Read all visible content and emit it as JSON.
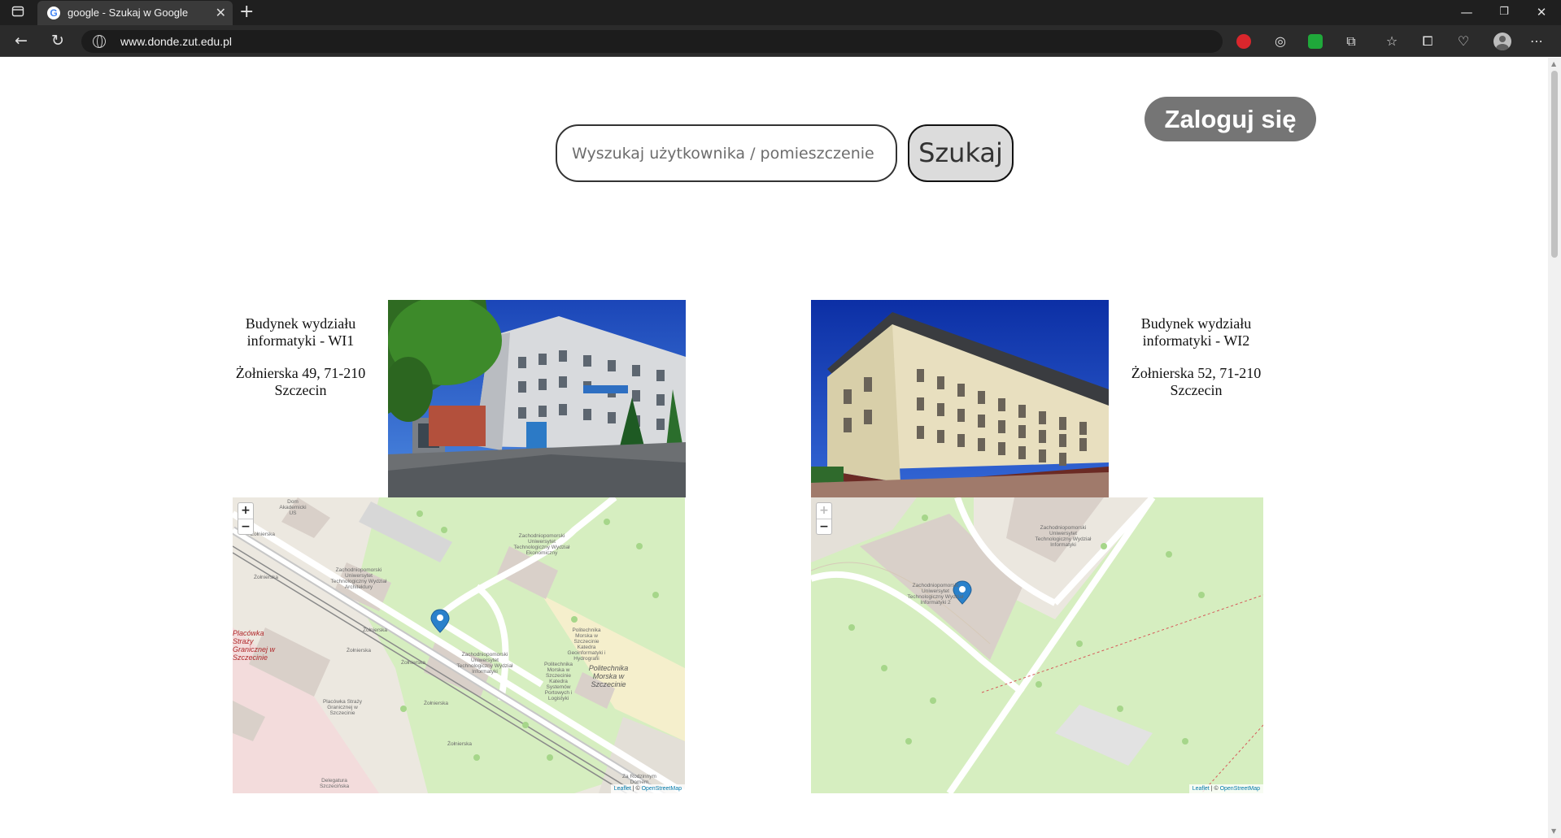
{
  "browser": {
    "tab_title": "google - Szukaj w Google",
    "url": "www.donde.zut.edu.pl",
    "new_tab_symbol": "+",
    "menu_symbol": "⋯"
  },
  "search": {
    "placeholder": "Wyszukaj użytkownika / pomieszczenie",
    "button_label": "Szukaj"
  },
  "login": {
    "label": "Zaloguj się"
  },
  "buildings": [
    {
      "name": "Budynek wydziału informatyki - WI1",
      "address": "Żołnierska 49, 71-210 Szczecin",
      "map": {
        "labels": [
          "Dom Akademicki US",
          "Żołnierska",
          "Żołnierska",
          "Zachodniopomorski Uniwersytet Technologiczny Wydział Architektury",
          "Zachodniopomorski Uniwersytet Technologiczny Wydział Ekonomiczny",
          "Zachodniopomorski Uniwersytet Technologiczny Wydział Informatyki",
          "Politechnika Morska w Szczecinie",
          "Politechnika Morska w Szczecinie Katedra Geoinformatyki i Hydrografii",
          "Politechnika Morska w Szczecinie Katedra Systemów Portowych i Logistyki",
          "Żołnierska",
          "Żołnierska",
          "Żołnierska",
          "Żołnierska",
          "Żołnierska",
          "Placówka Straży Granicznej w Szczecinie",
          "Placówka Straży Granicznej w Szczecinie",
          "Delegatura Szczecińska",
          "Za Rodzinnym Domem"
        ],
        "zoom_in": "+",
        "zoom_out": "−",
        "attribution_leaflet": "Leaflet",
        "attribution_sep": " | © ",
        "attribution_osm": "OpenStreetMap"
      }
    },
    {
      "name": "Budynek wydziału informatyki - WI2",
      "address": "Żołnierska 52, 71-210 Szczecin",
      "map": {
        "labels": [
          "Zachodniopomorski Uniwersytet Technologiczny Wydział Informatyki 2",
          "Zachodniopomorski Uniwersytet Technologiczny Wydział Informatyki"
        ],
        "zoom_in": "+",
        "zoom_out": "−",
        "attribution_leaflet": "Leaflet",
        "attribution_sep": " | © ",
        "attribution_osm": "OpenStreetMap"
      }
    }
  ]
}
